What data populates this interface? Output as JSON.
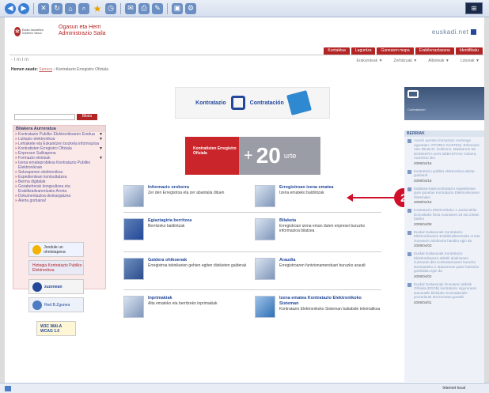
{
  "header": {
    "logo_words": "Eusko Jaurlaritza Gobierno Vasco",
    "department_line1": "Ogasun eta Herri",
    "department_line2": "Administrazio Saila",
    "portal": "euskadi.net"
  },
  "nav": {
    "tabs": [
      "Kontaktua",
      "Laguntza",
      "Gunearen mapa",
      "Erabilerraztasuna",
      "Identifikatu"
    ]
  },
  "subbar": {
    "font_sizes": "- I m I m",
    "dropdowns": [
      "Erakundeak ▼",
      "Zerbitzuak ▼",
      "Albisteak ▼",
      "Lotunak ▼"
    ]
  },
  "breadcrumb": {
    "label": "Hemen zaude:",
    "link": "Sarrera",
    "current": "Kontratazio Erregistro Ofiziala"
  },
  "sidebar": {
    "search_placeholder": "",
    "search_button": "Bilatu",
    "menu_title": "Bilakera Aurreratua",
    "items": [
      {
        "label": "Kontratazio Publiko Elektronikoaren Eredua",
        "arrow": "▼"
      },
      {
        "label": "Lizitazio elektronikoa",
        "arrow": "▼"
      },
      {
        "label": "Lehiakete eta Eskaintzen bozketa informazioa",
        "arrow": ""
      },
      {
        "label": "Kontratisten Erregistro Ofiziala",
        "arrow": "▼"
      },
      {
        "label": "Enpresen Sailkapena",
        "arrow": ""
      },
      {
        "label": "Formazio ekintzak",
        "arrow": "▼"
      },
      {
        "label": "Izena emateprobikoa Kontratazio Publiko Elektronikoan",
        "arrow": ""
      },
      {
        "label": "Sekzapenen elektronikoa",
        "arrow": ""
      },
      {
        "label": "Espedientean kontsultatzea",
        "arrow": ""
      },
      {
        "label": "Berma digitalak",
        "arrow": ""
      },
      {
        "label": "Gorabeherak kongsultzea eta Erabiltzailearentzako Arreta",
        "arrow": ""
      },
      {
        "label": "Dokumentazioa deskargatzea",
        "arrow": ""
      },
      {
        "label": "Alerta gorbaina!",
        "arrow": ""
      }
    ],
    "promos": [
      "Jondule un ohntxtapena",
      "Hiztegia Kontratazio Publiko Elektronikoa",
      "zuzenean",
      "Red B.Zgunea",
      "W3C WAI-A WCAG 1.0"
    ]
  },
  "banner": {
    "left_text": "Kontratazio",
    "right_text": "Contratación"
  },
  "anniversary": {
    "left_text": "Kontratisten Erregistro Ofiziala",
    "plus": "+",
    "number": "20",
    "word": "urte"
  },
  "services": [
    {
      "title": "Informazio orokorra",
      "desc": "Zer den Erregistroa eta zer abantaila dituen"
    },
    {
      "title": "Erregistroan izena ematea",
      "desc": "Izena emateko baldintzak"
    },
    {
      "title": "Egiaztagiria berritzea",
      "desc": "Berritzeko baldintzak"
    },
    {
      "title": "Bilaketa",
      "desc": "Erregistroan izena eman duten enpresei buruzko informazioa bilatzea"
    },
    {
      "title": "Galdera ohikoenak",
      "desc": "Erregistroa teknikarien gehien egiten diizkieten galderak"
    },
    {
      "title": "Araudia",
      "desc": "Erregistroaren funtzionamenduari buruzko araudi"
    },
    {
      "title": "Inprimakiak",
      "desc": "Alta emateko eta berritzeko inprimakiak"
    },
    {
      "title": "Izena ematea Kontratazio Elektronikoko Sisteman",
      "desc": "Kontratazio Elektronikoko Sisteman baliabide telematikoa"
    }
  ],
  "callout": {
    "number": "2"
  },
  "news": {
    "title": "BERRIAK",
    "items": [
      {
        "text": "Aurrez aurreko formazioa: Hurrengo egunetan: VITORIA-GASTEIZ, Erkemarin 15a: BILBAO: Gobierno, Masbarren 6a: DONOSTIA-SAN SEBASTIAN: Gebera, Aurrerino 2ko",
        "date": "2009/04/16"
      },
      {
        "text": "Kontratazio publiko elektronikoa alerta-gustiarat",
        "date": "2009/04/16"
      },
      {
        "text": "Edalatsa-baita kontratazio espedientea gure gunetan Kontratazio Elektronikoaren Sistemako",
        "date": "2009/04/15"
      },
      {
        "text": "Kontratazio Elektronikoko 1 Jardunaldia Donostiako hitza Azaroaren 23 eta 24ean hasiko",
        "date": "2009/04/08"
      },
      {
        "text": "Euskal Gaitasunak Kontratazio Elektronikoaren Erabiltzaileentzako Arreta Gunearen ahalmena handitu egin da",
        "date": "2009/04/03"
      },
      {
        "text": "Euskal Gaitasunak Kontratazio Elektronikoaren aldetik ahalmenen zuzenean ditu Kontratazioaren buruzko Nazioarteko 3. Batzarrean parte hartzeko gonbidatu egin da",
        "date": "2009/04/02"
      },
      {
        "text": "Euskal Gaitasunak Gunearen aldetik Ofiziala (EGOB) kontratazio ingurunean automatiki bildutako kontratatzaile prozedurak eta kontratu-gunetik",
        "date": "2009/04/01"
      }
    ]
  },
  "status": {
    "zone": "Internet local"
  },
  "colors": {
    "brand_red": "#b32525",
    "link_blue": "#23489a",
    "callout_red": "#d0102b"
  }
}
